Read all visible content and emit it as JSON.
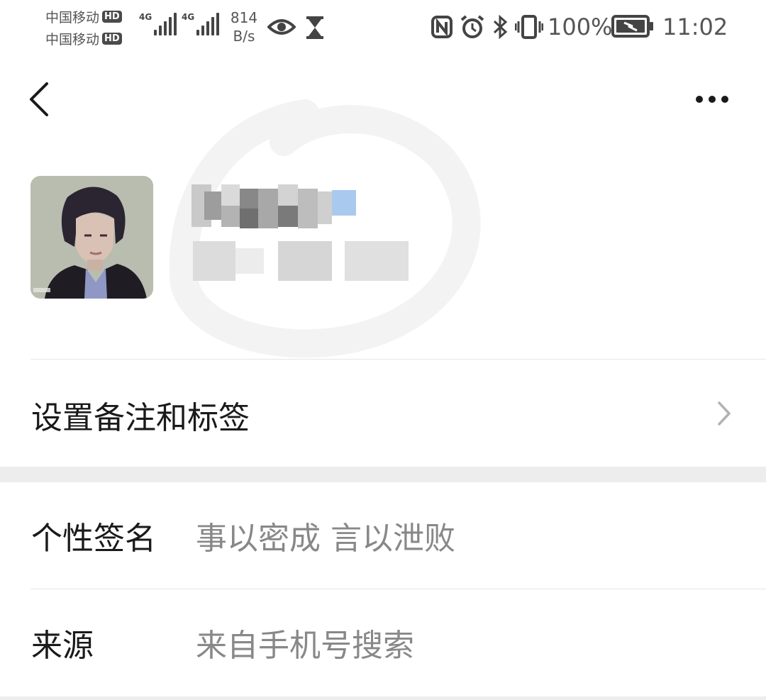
{
  "status_bar": {
    "carrier_1": "中国移动",
    "carrier_2": "中国移动",
    "hd_label": "HD",
    "signal_1_tag": "4G",
    "signal_2_tag": "4G",
    "speed_value": "814",
    "speed_unit": "B/s",
    "battery_percent": "100%",
    "time": "11:02",
    "icons": [
      "eye-icon",
      "hourglass-icon",
      "nfc-icon",
      "alarm-icon",
      "bluetooth-icon",
      "vibrate-icon",
      "battery-charging-icon"
    ]
  },
  "nav": {
    "back_icon": "chevron-left-icon",
    "more_icon": "more-horizontal-icon"
  },
  "menu": {
    "set_remark_label": "设置备注和标签"
  },
  "info": {
    "signature_key": "个性签名",
    "signature_value": "事以密成 言以泄败",
    "source_key": "来源",
    "source_value": "来自手机号搜索"
  },
  "colors": {
    "background": "#ffffff",
    "divider": "#e6e6e6",
    "section_gap": "#ededed",
    "secondary_text": "#888888",
    "primary_text": "#1a1a1a"
  }
}
